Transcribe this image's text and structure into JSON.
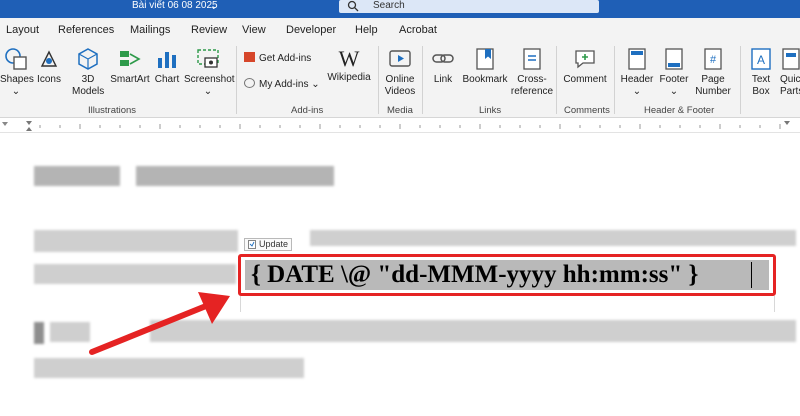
{
  "titlebar": {
    "filename": "Bài viết 06 08 2025",
    "search_label": "Search",
    "accent": "#1f5fb6"
  },
  "tabs": [
    "Layout",
    "References",
    "Mailings",
    "Review",
    "View",
    "Developer",
    "Help",
    "Acrobat"
  ],
  "ribbon": {
    "illustrations": {
      "shapes": "Shapes",
      "icons": "Icons",
      "models_line1": "3D",
      "models_line2": "Models",
      "smartart": "SmartArt",
      "chart": "Chart",
      "screenshot": "Screenshot",
      "group": "Illustrations"
    },
    "addins": {
      "get": "Get Add-ins",
      "my": "My Add-ins",
      "wikipedia": "Wikipedia",
      "group": "Add-ins"
    },
    "media": {
      "online_line1": "Online",
      "online_line2": "Videos",
      "group": "Media"
    },
    "links": {
      "link": "Link",
      "bookmark": "Bookmark",
      "cross_line1": "Cross-",
      "cross_line2": "reference",
      "group": "Links"
    },
    "comments": {
      "comment": "Comment",
      "group": "Comments"
    },
    "header_footer": {
      "header": "Header",
      "footer": "Footer",
      "page_line1": "Page",
      "page_line2": "Number",
      "group": "Header & Footer"
    },
    "text": {
      "textbox_line1": "Text",
      "textbox_line2": "Box",
      "quick_line1": "Quic",
      "quick_line2": "Parts"
    }
  },
  "document": {
    "update_label": "Update",
    "field_code": "{ DATE \\@ \"dd-MMM-yyyy hh:mm:ss\" }",
    "highlight_color": "#e52323"
  }
}
